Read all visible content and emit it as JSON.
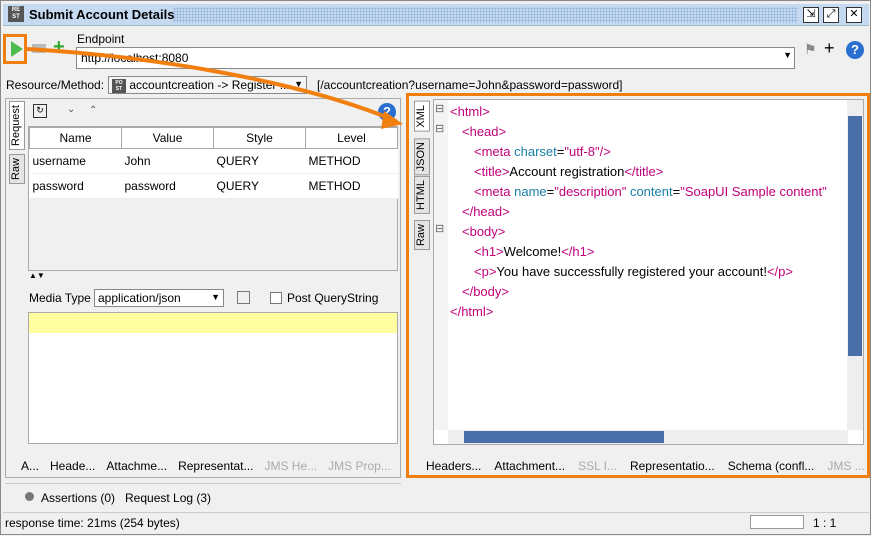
{
  "window": {
    "title": "Submit Account Details",
    "icon_text": "RE ST"
  },
  "toolbar": {
    "endpoint_label": "Endpoint",
    "endpoint_value": "http://localhost:8080"
  },
  "resource": {
    "label": "Resource/Method:",
    "selected": "accountcreation -> Register ...",
    "url": "[/accountcreation?username=John&password=password]",
    "icon_text": "PO ST"
  },
  "request": {
    "tabs": [
      "Request",
      "Raw"
    ],
    "columns": [
      "Name",
      "Value",
      "Style",
      "Level"
    ],
    "rows": [
      [
        "username",
        "John",
        "QUERY",
        "METHOD"
      ],
      [
        "password",
        "password",
        "QUERY",
        "METHOD"
      ]
    ],
    "media_type_label": "Media Type",
    "media_type_value": "application/json",
    "post_querystring_label": "Post QueryString",
    "bottom_tabs": [
      {
        "label": "A...",
        "disabled": false
      },
      {
        "label": "Heade...",
        "disabled": false
      },
      {
        "label": "Attachme...",
        "disabled": false
      },
      {
        "label": "Representat...",
        "disabled": false
      },
      {
        "label": "JMS He...",
        "disabled": true
      },
      {
        "label": "JMS Prop...",
        "disabled": true
      }
    ]
  },
  "response": {
    "tabs": [
      "XML",
      "JSON",
      "HTML",
      "Raw"
    ],
    "code_lines": [
      {
        "indent": 0,
        "parts": [
          [
            "tag",
            "<html>"
          ]
        ]
      },
      {
        "indent": 1,
        "parts": [
          [
            "tag",
            "<head>"
          ]
        ]
      },
      {
        "indent": 2,
        "parts": [
          [
            "tag",
            "<meta "
          ],
          [
            "attr",
            "charset"
          ],
          [
            "txt",
            "="
          ],
          [
            "val",
            "\"utf-8\""
          ],
          [
            "tag",
            "/>"
          ]
        ]
      },
      {
        "indent": 2,
        "parts": [
          [
            "tag",
            "<title>"
          ],
          [
            "txt",
            "Account registration"
          ],
          [
            "tag",
            "</title>"
          ]
        ]
      },
      {
        "indent": 2,
        "parts": [
          [
            "tag",
            "<meta "
          ],
          [
            "attr",
            "name"
          ],
          [
            "txt",
            "="
          ],
          [
            "val",
            "\"description\""
          ],
          [
            "attr",
            " content"
          ],
          [
            "txt",
            "="
          ],
          [
            "val",
            "\"SoapUI Sample content\""
          ]
        ]
      },
      {
        "indent": 1,
        "parts": [
          [
            "tag",
            "</head>"
          ]
        ]
      },
      {
        "indent": 1,
        "parts": [
          [
            "tag",
            "<body>"
          ]
        ]
      },
      {
        "indent": 2,
        "parts": [
          [
            "tag",
            "<h1>"
          ],
          [
            "txt",
            "Welcome!"
          ],
          [
            "tag",
            "</h1>"
          ]
        ]
      },
      {
        "indent": 2,
        "parts": [
          [
            "tag",
            "<p>"
          ],
          [
            "txt",
            "You have successfully registered your account!"
          ],
          [
            "tag",
            "</p>"
          ]
        ]
      },
      {
        "indent": 1,
        "parts": [
          [
            "tag",
            "</body>"
          ]
        ]
      },
      {
        "indent": 0,
        "parts": [
          [
            "tag",
            "</html>"
          ]
        ]
      }
    ],
    "bottom_tabs": [
      {
        "label": "Headers...",
        "disabled": false
      },
      {
        "label": "Attachment...",
        "disabled": false
      },
      {
        "label": "SSL I...",
        "disabled": true
      },
      {
        "label": "Representatio...",
        "disabled": false
      },
      {
        "label": "Schema (confl...",
        "disabled": false
      },
      {
        "label": "JMS ...",
        "disabled": true
      }
    ]
  },
  "footer": {
    "assertions": "Assertions (0)",
    "request_log": "Request Log (3)"
  },
  "status": {
    "text": "response time: 21ms (254 bytes)",
    "position": "1 : 1"
  },
  "colors": {
    "accent": "#f07f10",
    "tag": "#c0007a",
    "attr": "#1a7fa8"
  }
}
